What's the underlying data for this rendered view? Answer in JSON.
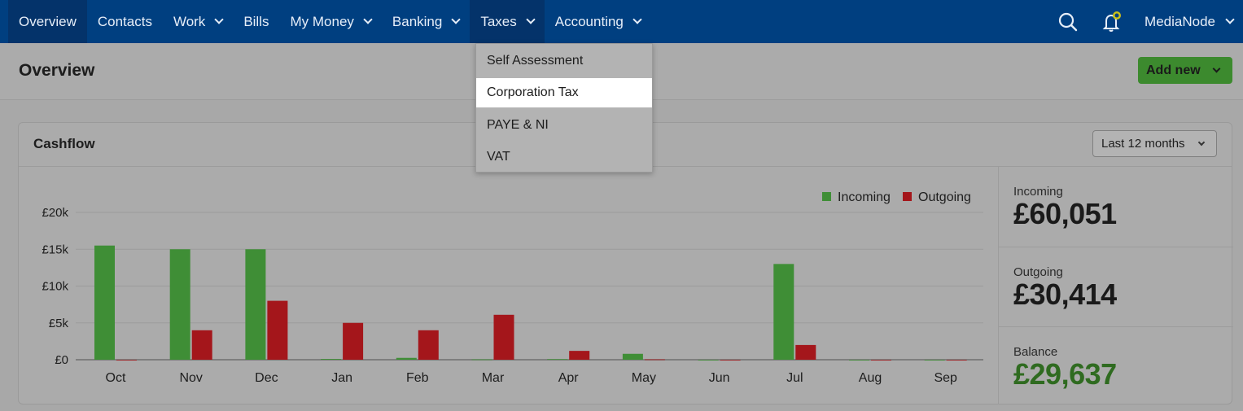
{
  "nav": {
    "items": [
      {
        "label": "Overview",
        "chevron": false
      },
      {
        "label": "Contacts",
        "chevron": false
      },
      {
        "label": "Work",
        "chevron": true
      },
      {
        "label": "Bills",
        "chevron": false
      },
      {
        "label": "My Money",
        "chevron": true
      },
      {
        "label": "Banking",
        "chevron": true
      },
      {
        "label": "Taxes",
        "chevron": true
      },
      {
        "label": "Accounting",
        "chevron": true
      }
    ],
    "user": "MediaNode",
    "icons": [
      "search-icon",
      "bell-icon"
    ]
  },
  "page": {
    "title": "Overview",
    "add_new": "Add new"
  },
  "taxes_menu": {
    "items": [
      "Self Assessment",
      "Corporation Tax",
      "PAYE & NI",
      "VAT"
    ],
    "highlighted": "Corporation Tax"
  },
  "cashflow": {
    "title": "Cashflow",
    "period": "Last 12 months",
    "stats": {
      "incoming_label": "Incoming",
      "incoming_value": "£60,051",
      "outgoing_label": "Outgoing",
      "outgoing_value": "£30,414",
      "balance_label": "Balance",
      "balance_value": "£29,637"
    }
  },
  "colors": {
    "nav_bg": "#003f80",
    "incoming": "#3f8e36",
    "outgoing": "#a4161b",
    "balance": "#2f6b20",
    "button": "#3c8a2e"
  },
  "chart_data": {
    "type": "bar",
    "categories": [
      "Oct",
      "Nov",
      "Dec",
      "Jan",
      "Feb",
      "Mar",
      "Apr",
      "May",
      "Jun",
      "Jul",
      "Aug",
      "Sep"
    ],
    "series": [
      {
        "name": "Incoming",
        "values": [
          15500,
          15000,
          15000,
          100,
          250,
          50,
          80,
          800,
          0,
          13000,
          0,
          0
        ]
      },
      {
        "name": "Outgoing",
        "values": [
          0,
          4000,
          8000,
          5000,
          4000,
          6100,
          1200,
          50,
          0,
          2000,
          0,
          0
        ]
      }
    ],
    "y_ticks": [
      "£0",
      "£5k",
      "£10k",
      "£15k",
      "£20k"
    ],
    "ylim": [
      0,
      20000
    ],
    "grid": true,
    "legend": "top-right"
  }
}
